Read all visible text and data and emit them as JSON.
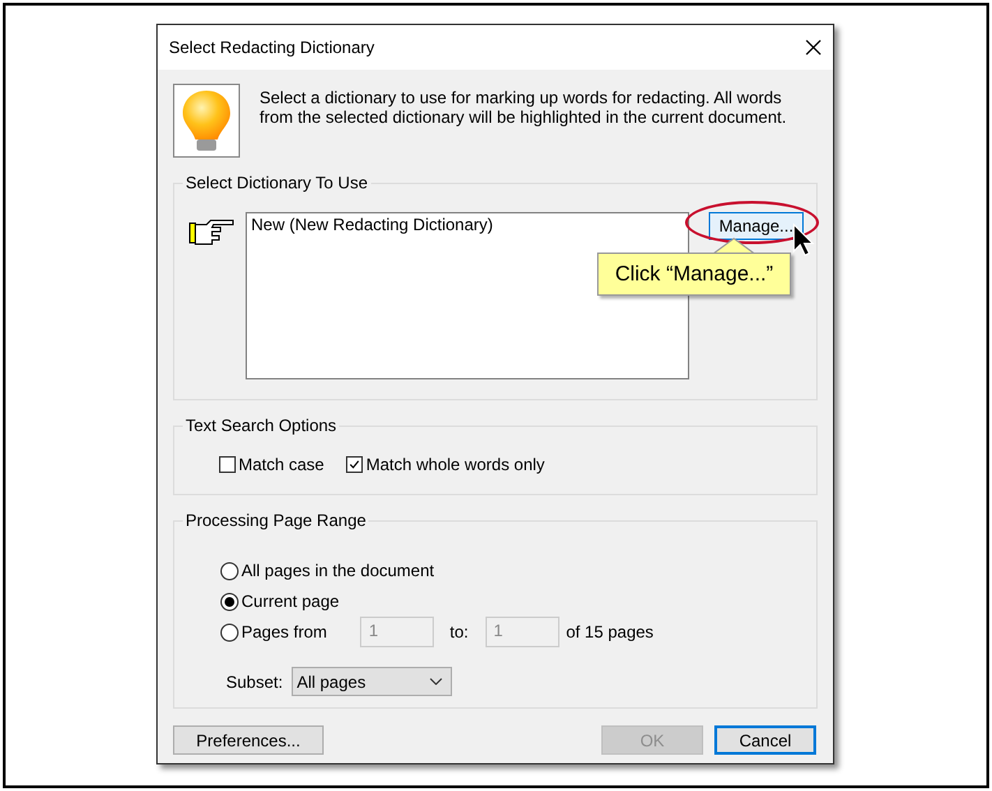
{
  "window": {
    "title": "Select Redacting Dictionary"
  },
  "intro": "Select a dictionary to use for marking up words for redacting. All words from the selected dictionary will be highlighted in the current document.",
  "dictionary_group": {
    "title": "Select Dictionary To Use",
    "items": [
      {
        "label": "New (New Redacting Dictionary)",
        "selected": false
      }
    ],
    "manage_button": "Manage..."
  },
  "callout": {
    "text": "Click “Manage...”"
  },
  "search_options": {
    "title": "Text Search Options",
    "options": [
      {
        "label": "Match case",
        "checked": false
      },
      {
        "label": "Match whole words only",
        "checked": true
      }
    ]
  },
  "page_range": {
    "title": "Processing Page Range",
    "options": [
      {
        "label": "All pages in the document",
        "selected": false
      },
      {
        "label": "Current page",
        "selected": true
      },
      {
        "label": "Pages from",
        "selected": false
      }
    ],
    "from": {
      "value": "1",
      "disabled": true
    },
    "to_label": "to:",
    "to": {
      "value": "1",
      "disabled": true
    },
    "of_label": "of 15 pages",
    "subset_label": "Subset:",
    "subset": "All pages"
  },
  "buttons": [
    {
      "label": "Preferences...",
      "disabled": false,
      "default": false
    },
    {
      "label": "OK",
      "disabled": true,
      "default": false
    },
    {
      "label": "Cancel",
      "disabled": false,
      "default": true
    }
  ]
}
